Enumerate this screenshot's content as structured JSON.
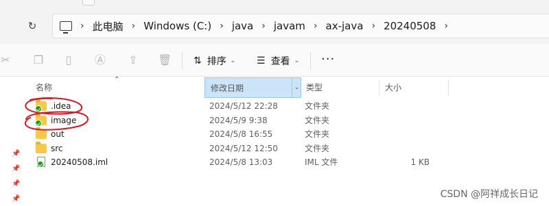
{
  "address_bar": {
    "crumbs": [
      "此电脑",
      "Windows (C:)",
      "java",
      "javam",
      "ax-java",
      "20240508"
    ]
  },
  "toolbar": {
    "sort_label": "排序",
    "view_label": "查看",
    "more_label": "···"
  },
  "columns": {
    "name": "名称",
    "date": "修改日期",
    "type": "类型",
    "size": "大小"
  },
  "files": [
    {
      "name": ".idea",
      "date": "2024/5/12 22:28",
      "type": "文件夹",
      "size": "",
      "kind": "folder",
      "synced": true
    },
    {
      "name": "image",
      "date": "2024/5/9 9:38",
      "type": "文件夹",
      "size": "",
      "kind": "folder",
      "synced": true
    },
    {
      "name": "out",
      "date": "2024/5/8 16:55",
      "type": "文件夹",
      "size": "",
      "kind": "folder",
      "synced": false
    },
    {
      "name": "src",
      "date": "2024/5/12 12:50",
      "type": "文件夹",
      "size": "",
      "kind": "folder",
      "synced": false
    },
    {
      "name": "20240508.iml",
      "date": "2024/5/8 13:03",
      "type": "IML 文件",
      "size": "1 KB",
      "kind": "file",
      "synced": true
    }
  ],
  "watermark": "CSDN @阿祥成长日记",
  "colors": {
    "selected_header": "#cce4f7",
    "folder": "#f7c948",
    "sync_check": "#13a10e",
    "annotation": "#e0141e"
  }
}
